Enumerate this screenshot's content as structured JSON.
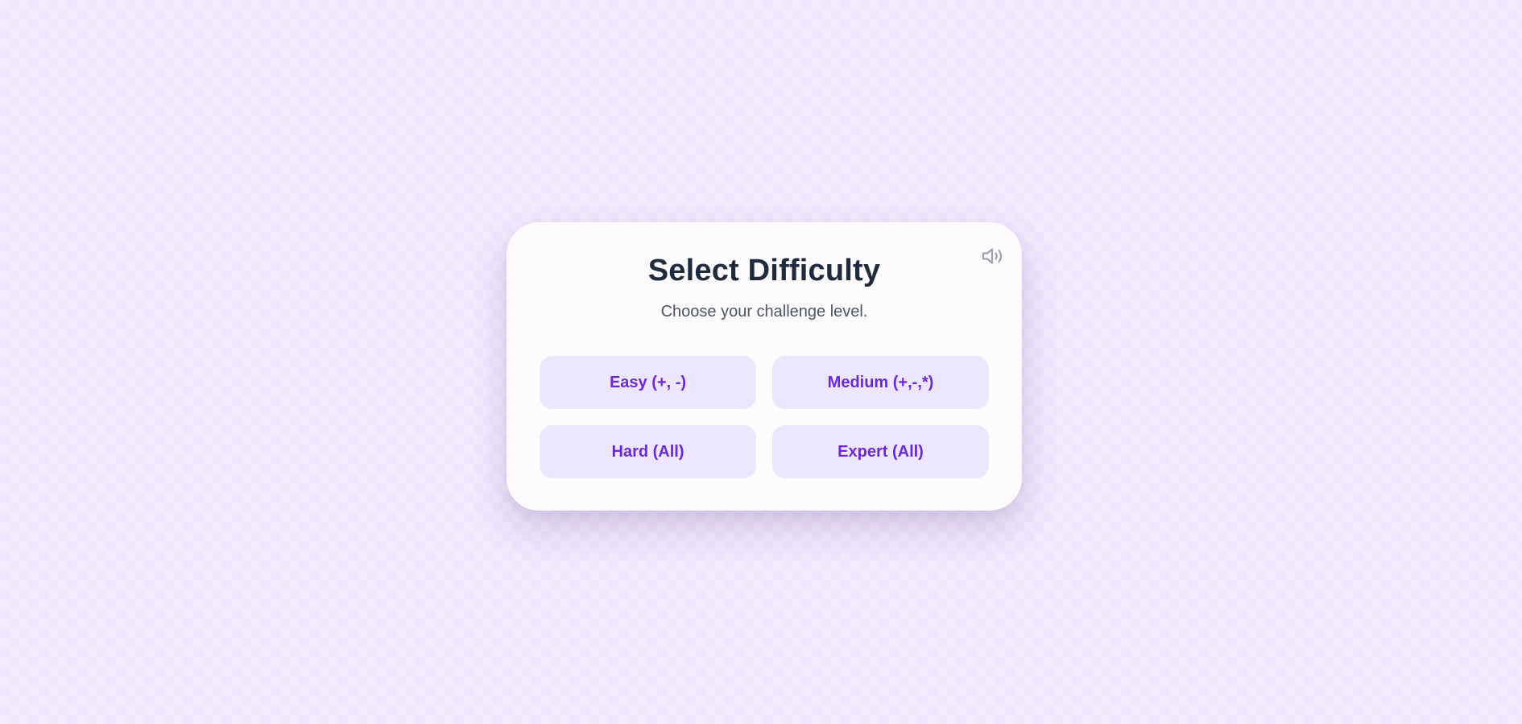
{
  "screen": {
    "title": "Select Difficulty",
    "subtitle": "Choose your challenge level."
  },
  "sound_button": {
    "icon": "speaker-volume-icon"
  },
  "difficulties": [
    {
      "label": "Easy (+, -)"
    },
    {
      "label": "Medium (+,-,*)"
    },
    {
      "label": "Hard (All)"
    },
    {
      "label": "Expert (All)"
    }
  ],
  "colors": {
    "background": "#f3eafd",
    "card": "#fdfbfe",
    "title": "#1f2a3d",
    "subtitle": "#4b5563",
    "button_bg": "#ece7fe",
    "button_text": "#6d28d9",
    "icon": "#9ca3af"
  }
}
